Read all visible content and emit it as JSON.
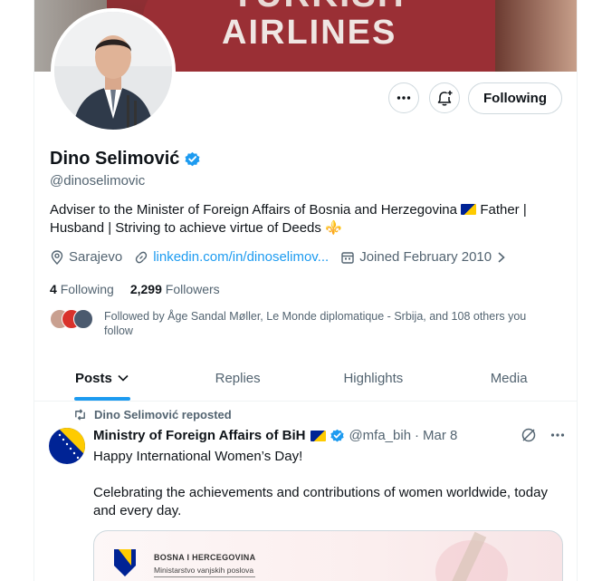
{
  "banner": {
    "line1": "TURKISH",
    "line2": "AIRLINES"
  },
  "profile": {
    "name": "Dino Selimović",
    "handle": "@dinoselimovic",
    "bio_part1": "Adviser to the Minister of Foreign Affairs of Bosnia and Herzegovina",
    "bio_part2": "Father | Husband | Striving to achieve virtue of Deeds",
    "bio_emoji": "⚜️",
    "location": "Sarajevo",
    "website": "linkedin.com/in/dinoselimov...",
    "joined": "Joined February 2010",
    "following_count": "4",
    "following_label": "Following",
    "followers_count": "2,299",
    "followers_label": "Followers",
    "followed_by": "Followed by Åge Sandal Møller, Le Monde diplomatique - Srbija, and 108 others you follow"
  },
  "actions": {
    "following_button": "Following",
    "more_icon": "more-icon",
    "notify_icon": "bell-plus-icon"
  },
  "tabs": [
    {
      "label": "Posts",
      "active": true
    },
    {
      "label": "Replies",
      "active": false
    },
    {
      "label": "Highlights",
      "active": false
    },
    {
      "label": "Media",
      "active": false
    }
  ],
  "tweet": {
    "repost_label": "Dino Selimović reposted",
    "author_name": "Ministry of Foreign Affairs of BiH",
    "author_handle": "@mfa_bih",
    "separator": "·",
    "date": "Mar 8",
    "text1": "Happy International Women’s Day!",
    "text2": "Celebrating the achievements and contributions of women worldwide, today and every day.",
    "media": {
      "line1": "BOSNA I HERCEGOVINA",
      "line2": "Ministarstvo vanjskih poslova"
    }
  },
  "colors": {
    "accent": "#1d9bf0",
    "muted": "#536471",
    "text": "#0f1419",
    "verified": "#1d9bf0"
  }
}
